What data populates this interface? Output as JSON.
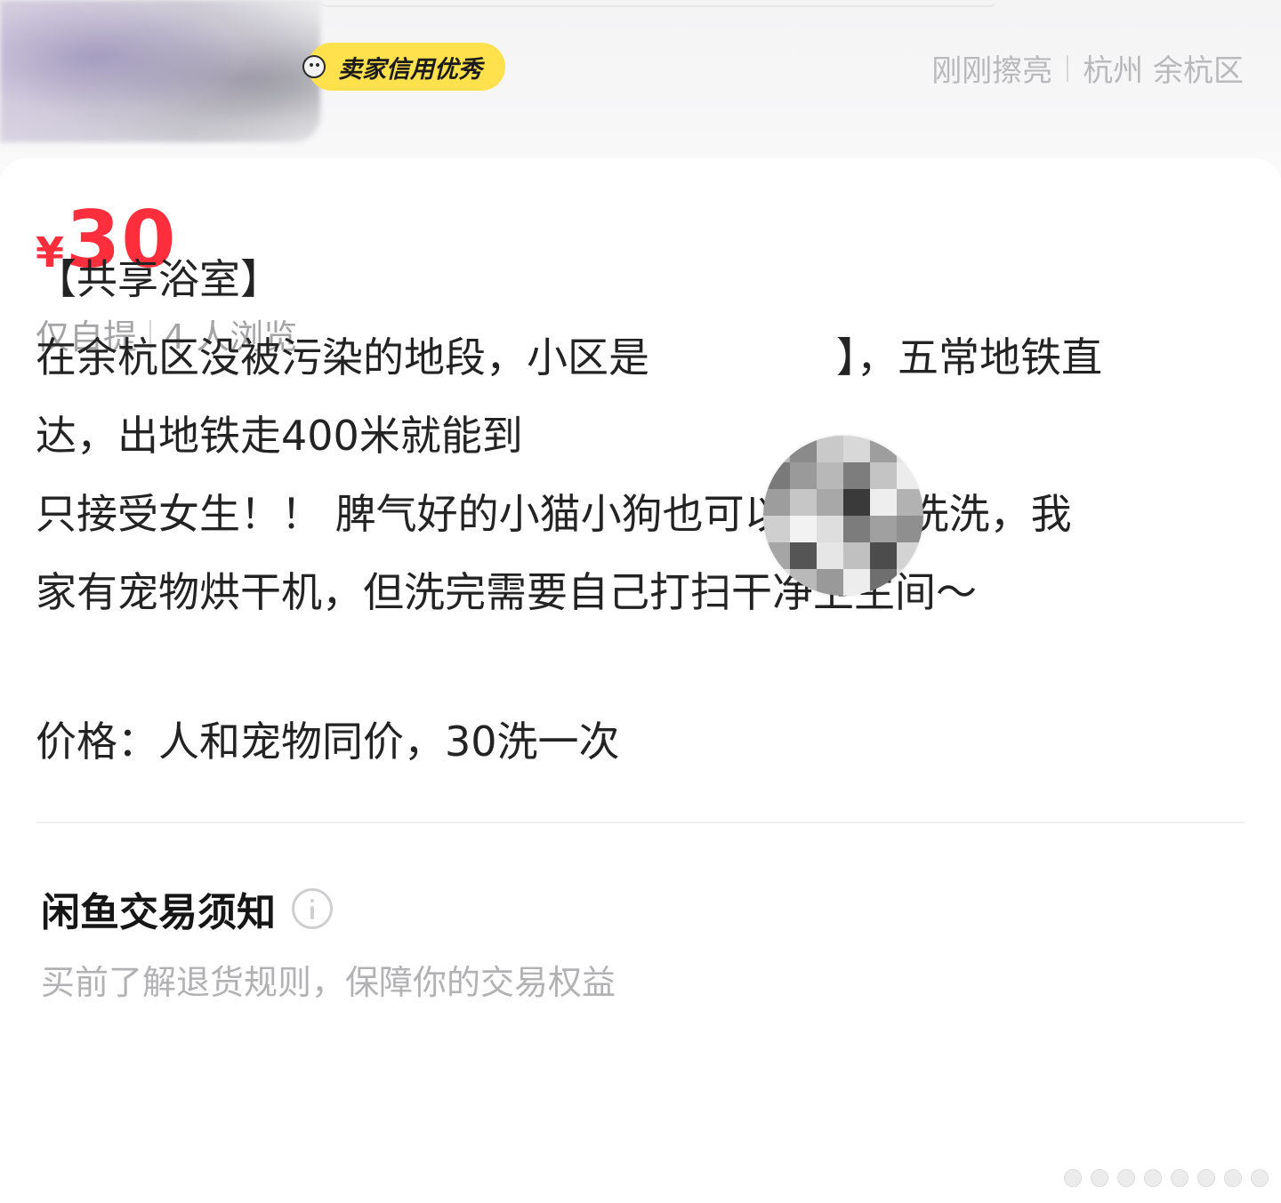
{
  "seller": {
    "badge_label": "卖家信用优秀",
    "status": "刚刚擦亮",
    "location": "杭州 余杭区"
  },
  "listing": {
    "currency_symbol": "¥",
    "price": "30",
    "delivery": "仅自提",
    "views": "4 人浏览"
  },
  "description": {
    "title_line": "【共享浴室】",
    "line2_before": "在余杭区没被污染的地段，小区是",
    "line2_after": "】，五常地铁直",
    "line3": "达，出地铁走400米就能到",
    "line4": "只接受女生！！ 脾气好的小猫小狗也可以来我家洗洗，我",
    "line5": "家有宠物烘干机，但洗完需要自己打扫干净卫生间～",
    "line6": "价格：人和宠物同价，30洗一次"
  },
  "notice": {
    "title": "闲鱼交易须知",
    "subtitle": "买前了解退货规则，保障你的交易权益"
  },
  "colors": {
    "price_red": "#ff2e3c",
    "badge_yellow": "#ffe14d",
    "muted_gray": "#a4a4a7"
  }
}
